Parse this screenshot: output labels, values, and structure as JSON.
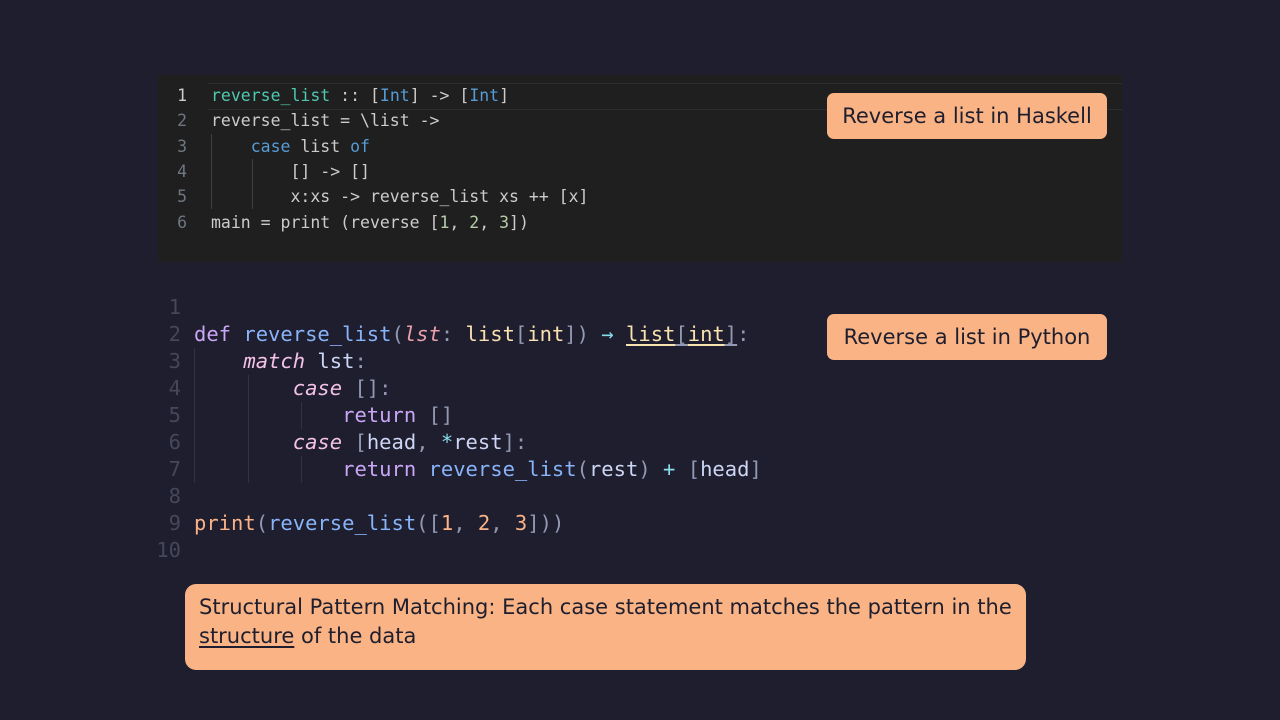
{
  "haskell": {
    "label": "Reverse a list in Haskell",
    "lines": [
      {
        "n": "1",
        "tokens": [
          {
            "t": "reverse_list",
            "c": "hs-type"
          },
          {
            "t": " :: ["
          },
          {
            "t": "Int",
            "c": "hs-kw"
          },
          {
            "t": "] -> ["
          },
          {
            "t": "Int",
            "c": "hs-kw"
          },
          {
            "t": "]"
          }
        ]
      },
      {
        "n": "2",
        "tokens": [
          {
            "t": "reverse_list = \\list ->"
          }
        ]
      },
      {
        "n": "3",
        "tokens": [
          {
            "t": "    "
          },
          {
            "t": "case",
            "c": "hs-kw"
          },
          {
            "t": " list "
          },
          {
            "t": "of",
            "c": "hs-kw"
          }
        ]
      },
      {
        "n": "4",
        "tokens": [
          {
            "t": "        [] -> []"
          }
        ]
      },
      {
        "n": "5",
        "tokens": [
          {
            "t": "        x:xs -> reverse_list xs ++ [x]"
          }
        ]
      },
      {
        "n": "6",
        "tokens": [
          {
            "t": "main = print (reverse ["
          },
          {
            "t": "1",
            "c": "hs-num"
          },
          {
            "t": ", "
          },
          {
            "t": "2",
            "c": "hs-num"
          },
          {
            "t": ", "
          },
          {
            "t": "3",
            "c": "hs-num"
          },
          {
            "t": "])"
          }
        ]
      }
    ]
  },
  "python": {
    "label": "Reverse a list in Python",
    "lines": [
      {
        "n": "1",
        "tokens": []
      },
      {
        "n": "2",
        "tokens": [
          {
            "t": "def",
            "c": "py-kw"
          },
          {
            "t": " "
          },
          {
            "t": "reverse_list",
            "c": "py-fn"
          },
          {
            "t": "(",
            "c": "py-br"
          },
          {
            "t": "lst",
            "c": "py-param"
          },
          {
            "t": ": ",
            "c": "py-br"
          },
          {
            "t": "list",
            "c": "py-type"
          },
          {
            "t": "[",
            "c": "py-br"
          },
          {
            "t": "int",
            "c": "py-type"
          },
          {
            "t": "]) ",
            "c": "py-br"
          },
          {
            "t": "→",
            "c": "py-op"
          },
          {
            "t": " "
          },
          {
            "t": "list",
            "c": "py-type ul"
          },
          {
            "t": "[",
            "c": "py-br ul"
          },
          {
            "t": "int",
            "c": "py-type ul"
          },
          {
            "t": "]",
            "c": "py-br ul"
          },
          {
            "t": ":",
            "c": "py-br"
          }
        ]
      },
      {
        "n": "3",
        "tokens": [
          {
            "t": "    "
          },
          {
            "t": "match",
            "c": "py-soft"
          },
          {
            "t": " lst"
          },
          {
            "t": ":",
            "c": "py-br"
          }
        ]
      },
      {
        "n": "4",
        "tokens": [
          {
            "t": "        "
          },
          {
            "t": "case",
            "c": "py-soft"
          },
          {
            "t": " []:",
            "c": "py-br"
          }
        ]
      },
      {
        "n": "5",
        "tokens": [
          {
            "t": "            "
          },
          {
            "t": "return",
            "c": "py-kw"
          },
          {
            "t": " []",
            "c": "py-br"
          }
        ]
      },
      {
        "n": "6",
        "tokens": [
          {
            "t": "        "
          },
          {
            "t": "case",
            "c": "py-soft"
          },
          {
            "t": " [",
            "c": "py-br"
          },
          {
            "t": "head"
          },
          {
            "t": ", ",
            "c": "py-br"
          },
          {
            "t": "*",
            "c": "py-op"
          },
          {
            "t": "rest"
          },
          {
            "t": "]:",
            "c": "py-br"
          }
        ]
      },
      {
        "n": "7",
        "tokens": [
          {
            "t": "            "
          },
          {
            "t": "return",
            "c": "py-kw"
          },
          {
            "t": " "
          },
          {
            "t": "reverse_list",
            "c": "py-fn"
          },
          {
            "t": "(",
            "c": "py-br"
          },
          {
            "t": "rest"
          },
          {
            "t": ") ",
            "c": "py-br"
          },
          {
            "t": "+",
            "c": "py-op"
          },
          {
            "t": " [",
            "c": "py-br"
          },
          {
            "t": "head"
          },
          {
            "t": "]",
            "c": "py-br"
          }
        ]
      },
      {
        "n": "8",
        "tokens": []
      },
      {
        "n": "9",
        "tokens": [
          {
            "t": "print",
            "c": "py-call"
          },
          {
            "t": "(",
            "c": "py-br"
          },
          {
            "t": "reverse_list",
            "c": "py-fn"
          },
          {
            "t": "([",
            "c": "py-br"
          },
          {
            "t": "1",
            "c": "py-num"
          },
          {
            "t": ", ",
            "c": "py-br"
          },
          {
            "t": "2",
            "c": "py-num"
          },
          {
            "t": ", ",
            "c": "py-br"
          },
          {
            "t": "3",
            "c": "py-num"
          },
          {
            "t": "]))",
            "c": "py-br"
          }
        ]
      },
      {
        "n": "10",
        "tokens": []
      }
    ]
  },
  "caption": {
    "before": "Structural Pattern Matching: Each case statement matches the pattern in the ",
    "emphasis": "structure",
    "after": " of the data"
  },
  "colors": {
    "background": "#1e1e2e",
    "haskell_editor_bg": "#1f1f1f",
    "label_bg": "#f9b384",
    "label_text": "#1e1e2e"
  }
}
